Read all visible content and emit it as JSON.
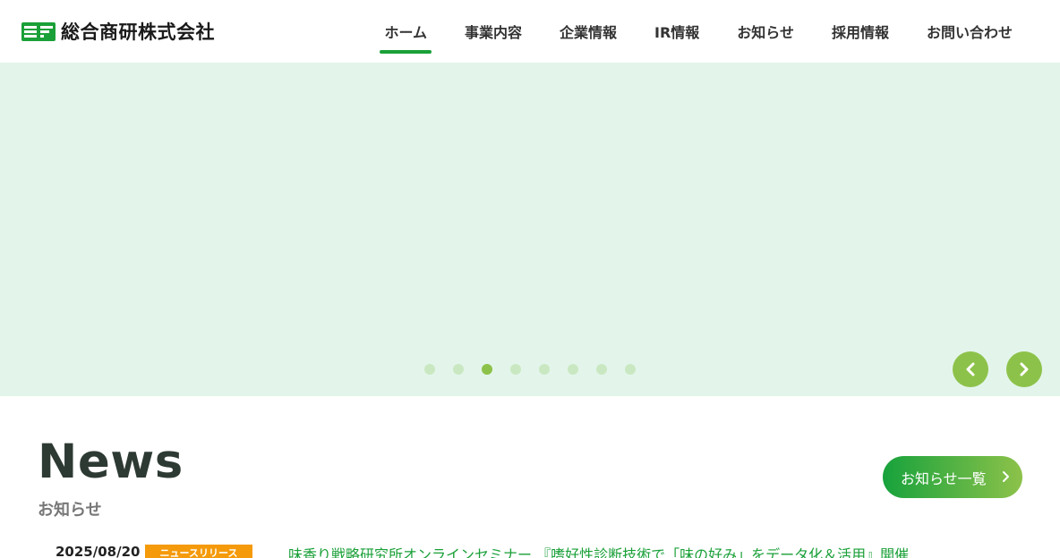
{
  "header": {
    "logo_text": "総合商研株式会社",
    "logo_mark_color": "#1aa038",
    "nav": [
      {
        "label": "ホーム",
        "active": true
      },
      {
        "label": "事業内容",
        "active": false
      },
      {
        "label": "企業情報",
        "active": false
      },
      {
        "label": "IR情報",
        "active": false
      },
      {
        "label": "お知らせ",
        "active": false
      },
      {
        "label": "採用情報",
        "active": false
      },
      {
        "label": "お問い合わせ",
        "active": false
      }
    ]
  },
  "hero": {
    "background_color": "#e3f5ea",
    "slide_count": 8,
    "active_slide": 3,
    "arrow_color": "#8dc24a",
    "prev_icon": "chevron-left-icon",
    "next_icon": "chevron-right-icon"
  },
  "news": {
    "title": "News",
    "subtitle": "お知らせ",
    "more_label": "お知らせ一覧",
    "items": [
      {
        "date": "2025/08/20",
        "category": "ニュースリリース",
        "title": "味香り戦略研究所オンラインセミナー 『嗜好性診断技術で「味の好み」をデータ化＆活用』開催"
      }
    ]
  },
  "colors": {
    "accent": "#1aa038",
    "badge": "#f59a0b"
  }
}
